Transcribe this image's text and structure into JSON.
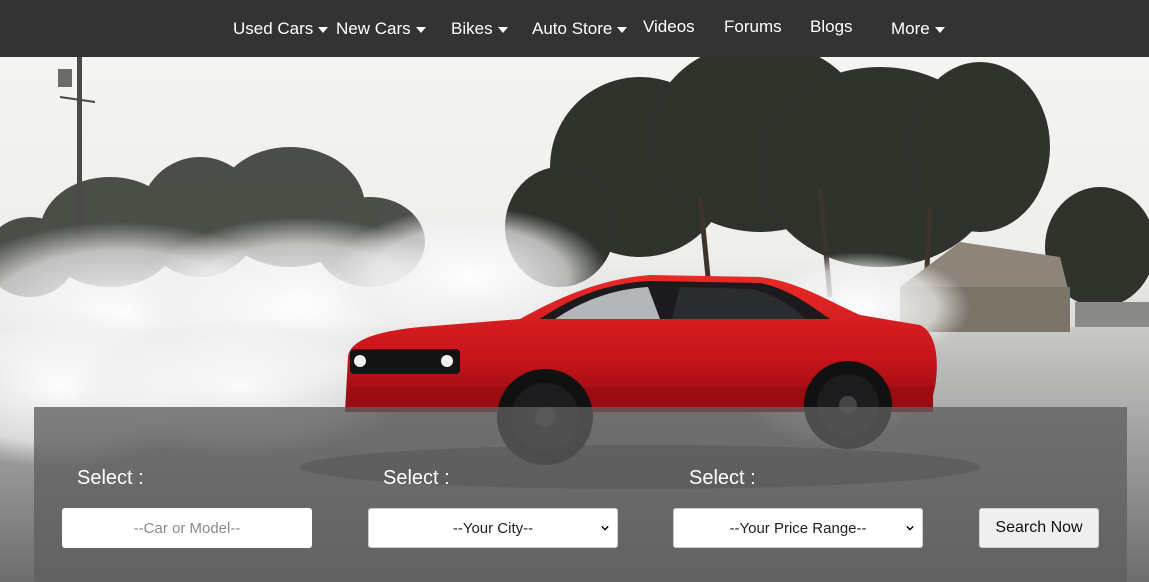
{
  "nav": {
    "items": [
      {
        "label": "Used Cars",
        "dropdown": true
      },
      {
        "label": "New Cars",
        "dropdown": true
      },
      {
        "label": "Bikes",
        "dropdown": true
      },
      {
        "label": "Auto Store",
        "dropdown": true
      },
      {
        "label": "Videos",
        "dropdown": false
      },
      {
        "label": "Forums",
        "dropdown": false
      },
      {
        "label": "Blogs",
        "dropdown": false
      },
      {
        "label": "More",
        "dropdown": true
      }
    ]
  },
  "search": {
    "labels": [
      "Select :",
      "Select :",
      "Select :"
    ],
    "model_placeholder": "--Car or Model--",
    "city_selected": "--Your City--",
    "price_selected": "--Your Price Range--",
    "button_label": "Search Now"
  },
  "colors": {
    "nav_bg": "#333333",
    "car_red": "#d8171c",
    "panel_overlay": "rgba(95,95,95,0.78)"
  },
  "icons": {
    "dropdown": "caret-down-icon",
    "select": "chevron-down-icon"
  }
}
